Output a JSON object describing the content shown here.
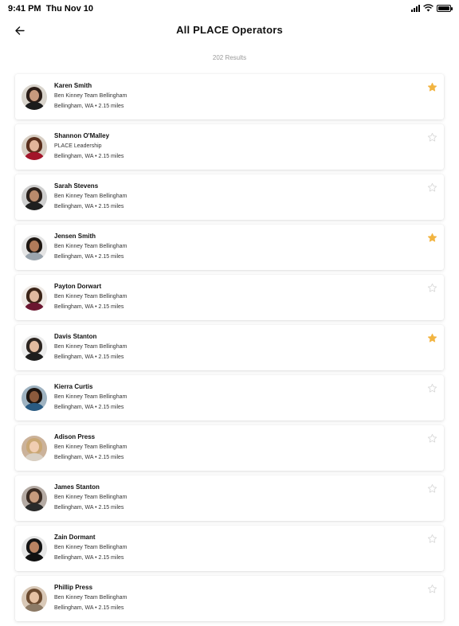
{
  "status_bar": {
    "time": "9:41 PM",
    "date": "Thu Nov 10",
    "icons": [
      "cellular-signal-icon",
      "wifi-icon",
      "battery-icon"
    ]
  },
  "header": {
    "back_icon": "arrow-left-icon",
    "title": "All PLACE Operators"
  },
  "results": {
    "label": "202 Results"
  },
  "colors": {
    "star_filled": "#F2B441",
    "star_empty": "#D8D8D8",
    "card_background": "#FFFFFF"
  },
  "operators": [
    {
      "name": "Karen Smith",
      "team": "Ben Kinney Team Bellingham",
      "location": "Bellingham, WA • 2.15 miles",
      "favorited": true,
      "star_icon": "star-filled-icon"
    },
    {
      "name": "Shannon O'Malley",
      "team": "PLACE Leadership",
      "location": "Bellingham, WA • 2.15 miles",
      "favorited": false,
      "star_icon": "star-outline-icon"
    },
    {
      "name": "Sarah Stevens",
      "team": "Ben Kinney Team Bellingham",
      "location": "Bellingham, WA • 2.15 miles",
      "favorited": false,
      "star_icon": "star-outline-icon"
    },
    {
      "name": "Jensen Smith",
      "team": "Ben Kinney Team Bellingham",
      "location": "Bellingham, WA • 2.15 miles",
      "favorited": true,
      "star_icon": "star-filled-icon"
    },
    {
      "name": "Payton Dorwart",
      "team": "Ben Kinney Team Bellingham",
      "location": "Bellingham, WA • 2.15 miles",
      "favorited": false,
      "star_icon": "star-outline-icon"
    },
    {
      "name": "Davis Stanton",
      "team": "Ben Kinney Team Bellingham",
      "location": "Bellingham, WA • 2.15 miles",
      "favorited": true,
      "star_icon": "star-filled-icon"
    },
    {
      "name": "Kierra Curtis",
      "team": "Ben Kinney Team Bellingham",
      "location": "Bellingham, WA • 2.15 miles",
      "favorited": false,
      "star_icon": "star-outline-icon"
    },
    {
      "name": "Adison Press",
      "team": "Ben Kinney Team Bellingham",
      "location": "Bellingham, WA • 2.15 miles",
      "favorited": false,
      "star_icon": "star-outline-icon"
    },
    {
      "name": "James Stanton",
      "team": "Ben Kinney Team Bellingham",
      "location": "Bellingham, WA • 2.15 miles",
      "favorited": false,
      "star_icon": "star-outline-icon"
    },
    {
      "name": "Zain Dormant",
      "team": "Ben Kinney Team Bellingham",
      "location": "Bellingham, WA • 2.15 miles",
      "favorited": false,
      "star_icon": "star-outline-icon"
    },
    {
      "name": "Phillip Press",
      "team": "Ben Kinney Team Bellingham",
      "location": "Bellingham, WA • 2.15 miles",
      "favorited": false,
      "star_icon": "star-outline-icon"
    }
  ]
}
